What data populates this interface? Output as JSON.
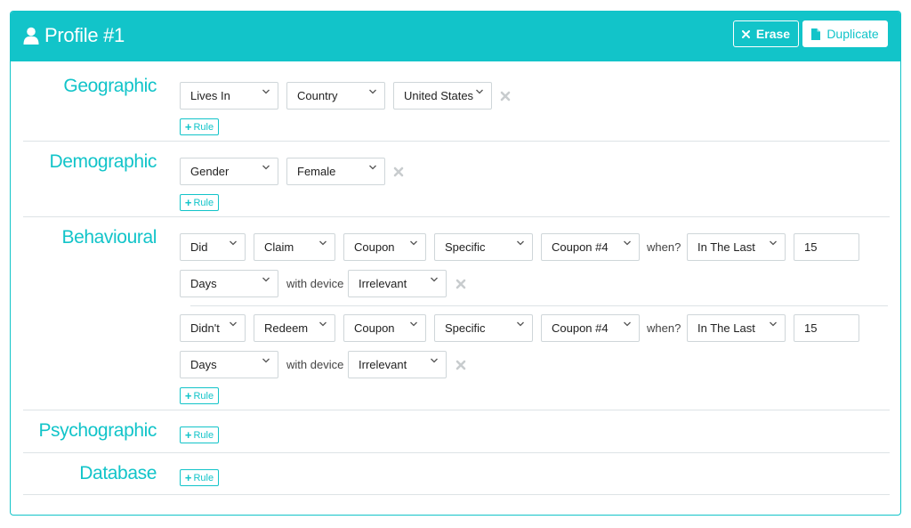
{
  "header": {
    "title": "Profile #1",
    "erase_label": "Erase",
    "duplicate_label": "Duplicate"
  },
  "colors": {
    "accent": "#12c4c9",
    "remove_icon": "#c8ccce",
    "divider": "#dde3e6"
  },
  "rule_label": "Rule",
  "sections": {
    "geographic": {
      "label": "Geographic",
      "row1": {
        "s1": "Lives In",
        "s2": "Country",
        "s3": "United States"
      }
    },
    "demographic": {
      "label": "Demographic",
      "row1": {
        "s1": "Gender",
        "s2": "Female"
      }
    },
    "behavioural": {
      "label": "Behavioural",
      "rule1": {
        "action": "Did",
        "verb": "Claim",
        "object": "Coupon",
        "scope": "Specific",
        "item": "Coupon #4",
        "when_label": "when?",
        "period": "In The Last",
        "amount": "15",
        "unit": "Days",
        "device_label": "with device",
        "device": "Irrelevant"
      },
      "rule2": {
        "action": "Didn't",
        "verb": "Redeem",
        "object": "Coupon",
        "scope": "Specific",
        "item": "Coupon #4",
        "when_label": "when?",
        "period": "In The Last",
        "amount": "15",
        "unit": "Days",
        "device_label": "with device",
        "device": "Irrelevant"
      }
    },
    "psychographic": {
      "label": "Psychographic"
    },
    "database": {
      "label": "Database"
    }
  }
}
